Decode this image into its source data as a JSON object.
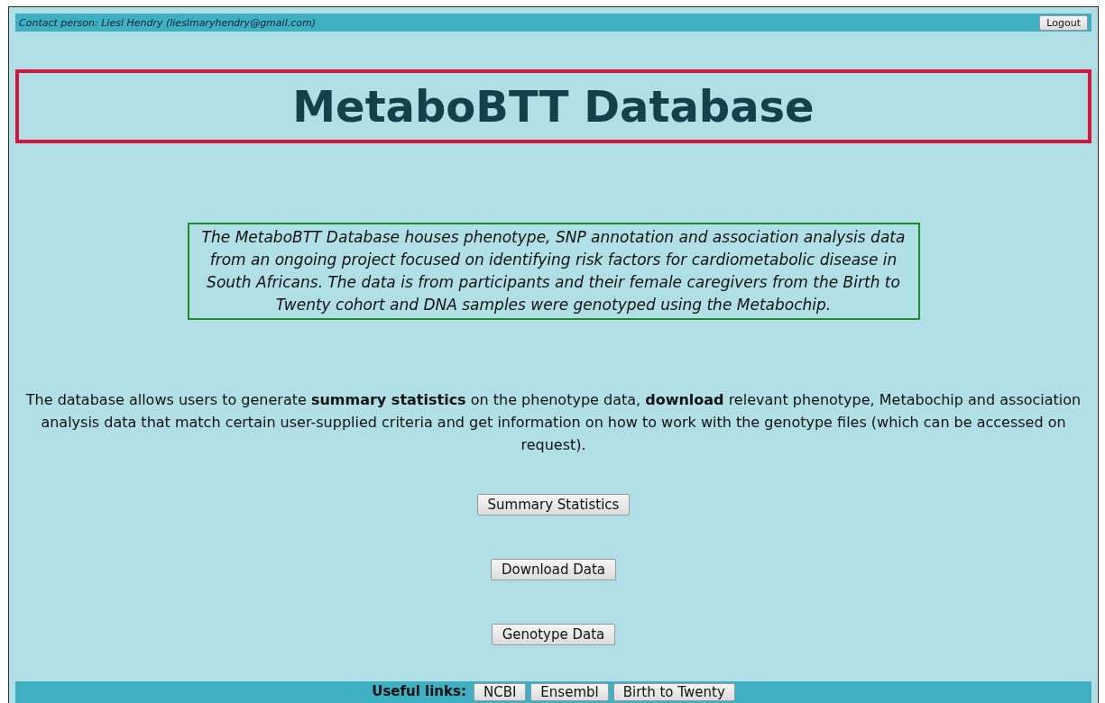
{
  "top_bar": {
    "contact": "Contact person: Liesl Hendry (lieslmaryhendry@gmail.com)",
    "logout_button": "Logout"
  },
  "title": "MetaboBTT Database",
  "description": "The MetaboBTT Database houses phenotype, SNP annotation and association analysis data from an ongoing project focused on identifying risk factors for cardiometabolic disease in South Africans. The data is from participants and their female caregivers from the Birth to Twenty cohort and DNA samples were genotyped using the Metabochip.",
  "intro": "The database allows users to generate **summary statistics** on the phenotype data, **download** relevant phenotype, Metabochip and association analysis data that match certain user-supplied criteria and get information on how to work with the genotype files (which can be accessed on request).",
  "actions": [
    "Summary Statistics",
    "Download Data",
    "Genotype Data"
  ],
  "footer": {
    "label": "Useful links:",
    "links": [
      "NCBI",
      "Ensembl",
      "Birth to Twenty"
    ]
  }
}
